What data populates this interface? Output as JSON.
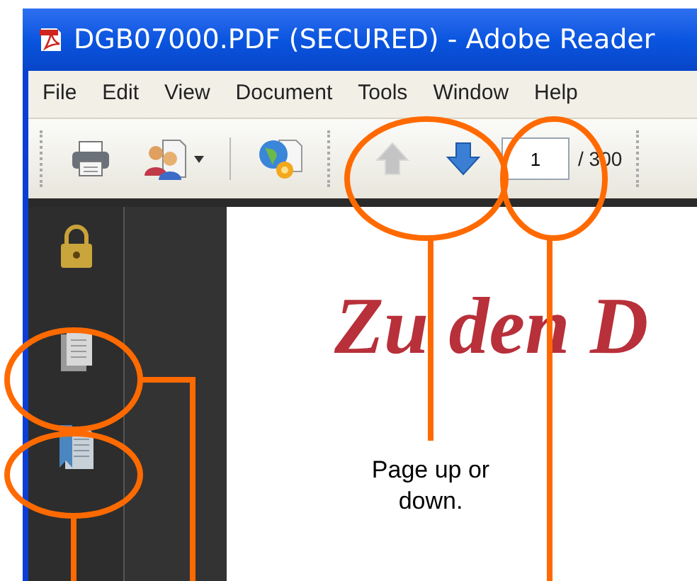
{
  "window": {
    "title": "DGB07000.PDF (SECURED) - Adobe Reader"
  },
  "menu": [
    "File",
    "Edit",
    "View",
    "Document",
    "Tools",
    "Window",
    "Help"
  ],
  "toolbar": {
    "page_up": {
      "disabled": true
    },
    "page_down": {
      "disabled": false
    },
    "page_field": {
      "value": "1"
    },
    "page_count": "/ 300"
  },
  "sidebar": {
    "items": [
      {
        "kind": "lock"
      },
      {
        "kind": "pages"
      },
      {
        "kind": "bookmarks"
      }
    ]
  },
  "document": {
    "heading": "Zu den D"
  },
  "annotation": {
    "text": "Page up or down."
  }
}
